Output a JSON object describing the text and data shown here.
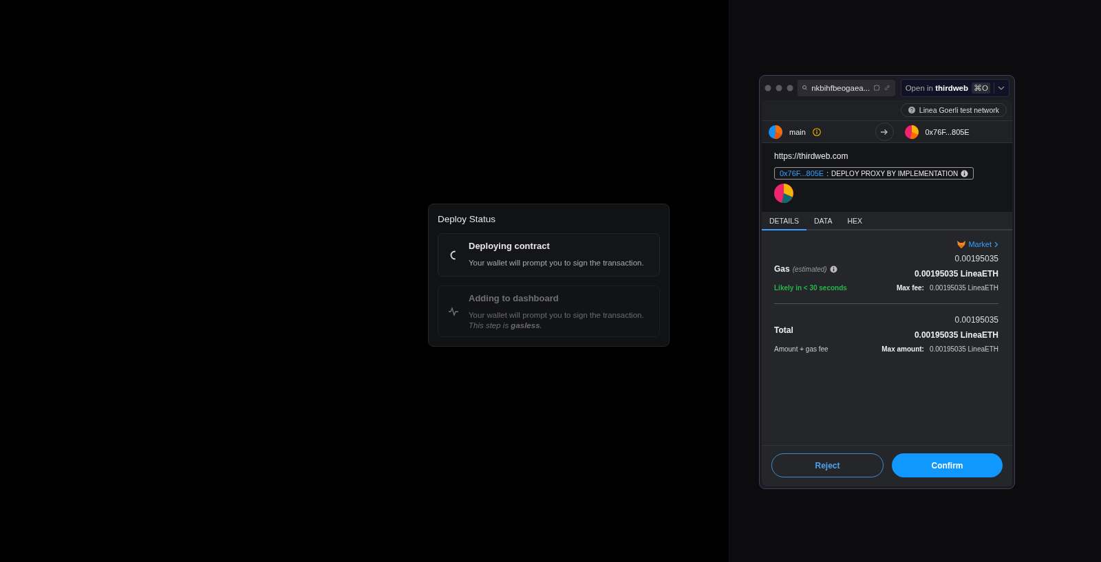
{
  "deploy_status": {
    "title": "Deploy Status",
    "steps": [
      {
        "kind": "spinner",
        "active": true,
        "title": "Deploying contract",
        "text": "Your wallet will prompt you to sign the transaction."
      },
      {
        "kind": "pulse",
        "active": false,
        "title": "Adding to dashboard",
        "text": "Your wallet will prompt you to sign the transaction.",
        "note": "This step is **gasless**."
      }
    ]
  },
  "wallet": {
    "address_bar": {
      "value": "nkbihfbeogaea..."
    },
    "open_button": {
      "label": "Open in **thirdweb**",
      "shortcut": "⌘O"
    },
    "network": "Linea Goerli test network",
    "from": {
      "name": "main"
    },
    "to": {
      "address": "0x76F...805E"
    },
    "origin": "https://thirdweb.com",
    "method": {
      "address": "0x76F...805E",
      "separator": ":",
      "name": "DEPLOY PROXY BY IMPLEMENTATION"
    },
    "tabs": [
      {
        "label": "DETAILS",
        "selected": true
      },
      {
        "label": "DATA",
        "selected": false
      },
      {
        "label": "HEX",
        "selected": false
      }
    ],
    "market": "Market",
    "gas": {
      "label": "Gas",
      "qualifier": "(estimated)",
      "amount": "0.00195035",
      "amount_bold": "0.00195035 LineaETH",
      "speed": "Likely in < 30 seconds",
      "max_label": "Max fee:",
      "max_value": "0.00195035 LineaETH"
    },
    "total": {
      "label": "Total",
      "amount": "0.00195035",
      "amount_bold": "0.00195035 LineaETH",
      "sub": "Amount + gas fee",
      "max_label": "Max amount:",
      "max_value": "0.00195035 LineaETH"
    },
    "buttons": {
      "reject": "Reject",
      "confirm": "Confirm"
    }
  }
}
